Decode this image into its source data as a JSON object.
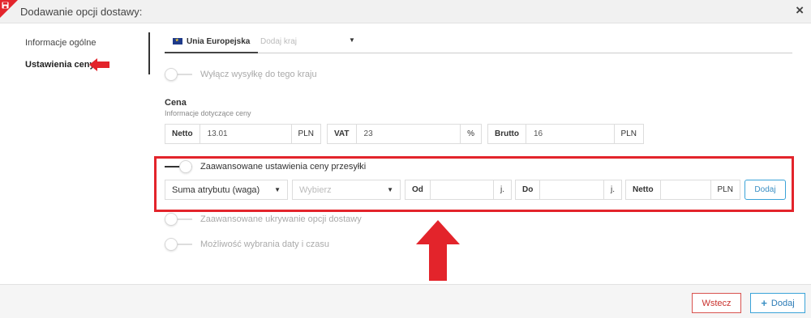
{
  "window": {
    "title": "Dodawanie opcji dostawy:",
    "close_icon": "×",
    "badge_icon": "save-icon"
  },
  "sidebar": {
    "items": [
      {
        "label": "Informacje ogólne"
      },
      {
        "label": "Ustawienia ceny"
      }
    ]
  },
  "tabs": {
    "active": "Unia Europejska",
    "add_country": "Dodaj kraj",
    "caret": "▼"
  },
  "toggles": {
    "disable_shipping": "Wyłącz wysyłkę do tego kraju",
    "advanced_price": "Zaawansowane ustawienia ceny przesyłki",
    "advanced_hiding": "Zaawansowane ukrywanie opcji dostawy",
    "date_time": "Możliwość wybrania daty i czasu"
  },
  "price": {
    "title": "Cena",
    "subtitle": "Informacje dotyczące ceny",
    "netto_label": "Netto",
    "netto_value": "13.01",
    "netto_unit": "PLN",
    "vat_label": "VAT",
    "vat_value": "23",
    "vat_unit": "%",
    "brutto_label": "Brutto",
    "brutto_value": "16",
    "brutto_unit": "PLN"
  },
  "advanced": {
    "attribute_select": "Suma atrybutu (waga)",
    "choose_select": "Wybierz",
    "from_label": "Od",
    "from_unit": "j.",
    "to_label": "Do",
    "to_unit": "j.",
    "netto_label": "Netto",
    "netto_unit": "PLN",
    "add_button": "Dodaj"
  },
  "footer": {
    "back_button": "Wstecz",
    "add_button": "Dodaj"
  },
  "colors": {
    "annotation_red": "#e3242b",
    "accent_blue": "#3aa3d8"
  }
}
